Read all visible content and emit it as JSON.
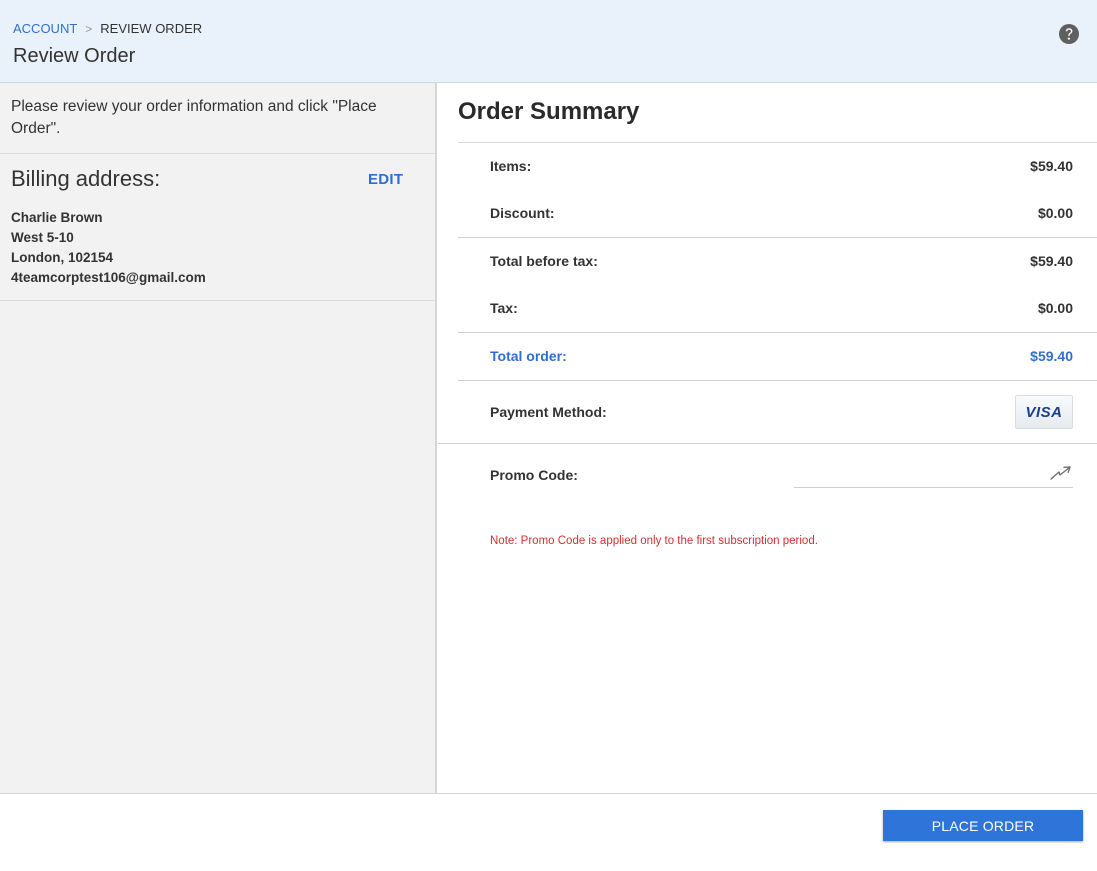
{
  "header": {
    "breadcrumb": {
      "parent": "ACCOUNT",
      "separator": ">",
      "current": "REVIEW ORDER"
    },
    "title": "Review Order",
    "help_icon": "question-circle-icon"
  },
  "left": {
    "instructions": "Please review your order information and click \"Place Order\".",
    "billing": {
      "title": "Billing address:",
      "edit_label": "EDIT",
      "name": "Charlie Brown",
      "street": "West 5-10",
      "city_postal": "London, 102154",
      "email": "4teamcorptest106@gmail.com"
    }
  },
  "summary": {
    "title": "Order Summary",
    "items": {
      "label": "Items:",
      "value": "$59.40"
    },
    "discount": {
      "label": "Discount:",
      "value": "$0.00"
    },
    "total_before_tax": {
      "label": "Total before tax:",
      "value": "$59.40"
    },
    "tax": {
      "label": "Tax:",
      "value": "$0.00"
    },
    "total_order": {
      "label": "Total order:",
      "value": "$59.40"
    },
    "payment_method": {
      "label": "Payment Method:",
      "card": "VISA"
    },
    "promo": {
      "label": "Promo Code:",
      "value": "",
      "apply_icon": "apply-arrow-icon",
      "note": "Note: Promo Code is applied only to the first subscription period."
    }
  },
  "footer": {
    "place_order_label": "PLACE ORDER"
  },
  "colors": {
    "accent": "#2f74d8",
    "link": "#2f6fcf",
    "note": "#d32f2f",
    "header_bg": "#e9f1fa"
  }
}
